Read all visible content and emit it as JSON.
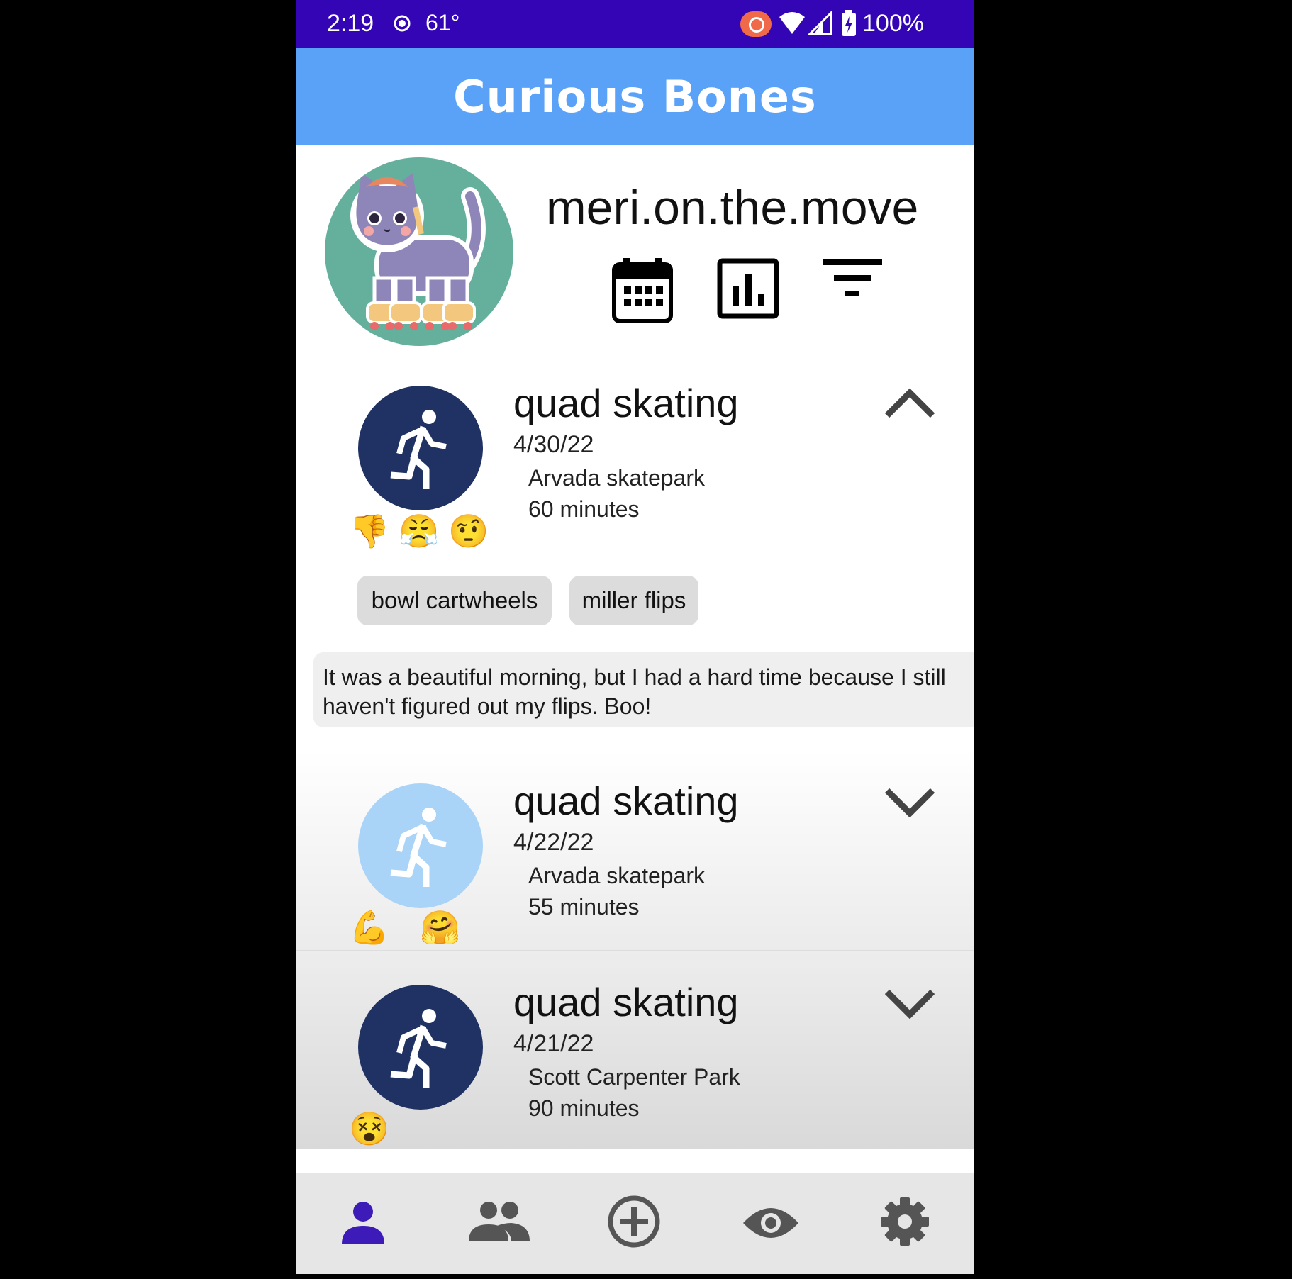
{
  "status_bar": {
    "time": "2:19",
    "temperature": "61°",
    "battery": "100%"
  },
  "app": {
    "title": "Curious Bones"
  },
  "profile": {
    "username": "meri.on.the.move",
    "actions": [
      "calendar-icon",
      "bar-chart-icon",
      "filter-icon"
    ]
  },
  "entries": [
    {
      "activity": "quad skating",
      "date": "4/30/22",
      "location": "Arvada skatepark",
      "duration": "60 minutes",
      "expanded": true,
      "icon_color": "#1f3263",
      "emojis": [
        "👎",
        "😤",
        "🤨"
      ],
      "tags": [
        "bowl cartwheels",
        "miller flips"
      ],
      "note": "It was a beautiful morning, but I had a hard time because I still haven't figured out my flips. Boo!"
    },
    {
      "activity": "quad skating",
      "date": "4/22/22",
      "location": "Arvada skatepark",
      "duration": "55 minutes",
      "expanded": false,
      "icon_color": "#a9d3f7",
      "emojis": [
        "💪",
        "🤗"
      ]
    },
    {
      "activity": "quad skating",
      "date": "4/21/22",
      "location": "Scott Carpenter Park",
      "duration": "90 minutes",
      "expanded": false,
      "icon_color": "#1f3263",
      "emojis": [
        "😵"
      ]
    }
  ],
  "bottom_nav": {
    "items": [
      "profile-icon",
      "friends-icon",
      "add-icon",
      "eye-icon",
      "settings-icon"
    ],
    "active": "profile-icon",
    "active_color": "#3d1bb8"
  }
}
